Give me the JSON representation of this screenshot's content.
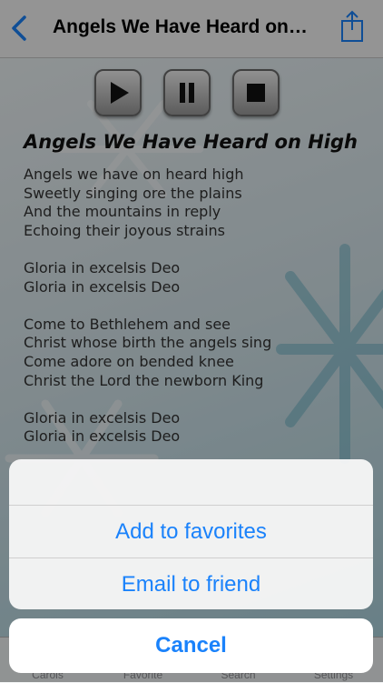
{
  "nav": {
    "title": "Angels We Have Heard on…",
    "back_icon": "chevron-left-icon",
    "share_icon": "share-icon"
  },
  "player": {
    "play_icon": "play-icon",
    "pause_icon": "pause-icon",
    "stop_icon": "stop-icon"
  },
  "song": {
    "title": "Angels We Have Heard on High",
    "lyrics": [
      "Angels we have on heard high",
      "Sweetly singing ore the plains",
      "And the mountains in reply",
      "Echoing their joyous strains",
      "",
      "Gloria in excelsis Deo",
      "Gloria in excelsis Deo",
      "",
      "Come to Bethlehem and see",
      "Christ whose birth the angels sing",
      "Come adore on bended knee",
      "Christ the Lord the newborn King",
      "",
      "Gloria in excelsis Deo",
      "Gloria in excelsis Deo",
      "",
      "",
      "",
      "",
      "",
      "",
      "",
      "",
      "",
      "",
      "Gloria in excelsis Deo"
    ]
  },
  "tabs": [
    {
      "label": "Carols"
    },
    {
      "label": "Favorite"
    },
    {
      "label": "Search"
    },
    {
      "label": "Settings"
    }
  ],
  "action_sheet": {
    "add_favorites": "Add to favorites",
    "email_friend": "Email to friend",
    "cancel": "Cancel"
  },
  "colors": {
    "accent": "#1a82fb",
    "tab_inactive": "#8e8e93"
  }
}
